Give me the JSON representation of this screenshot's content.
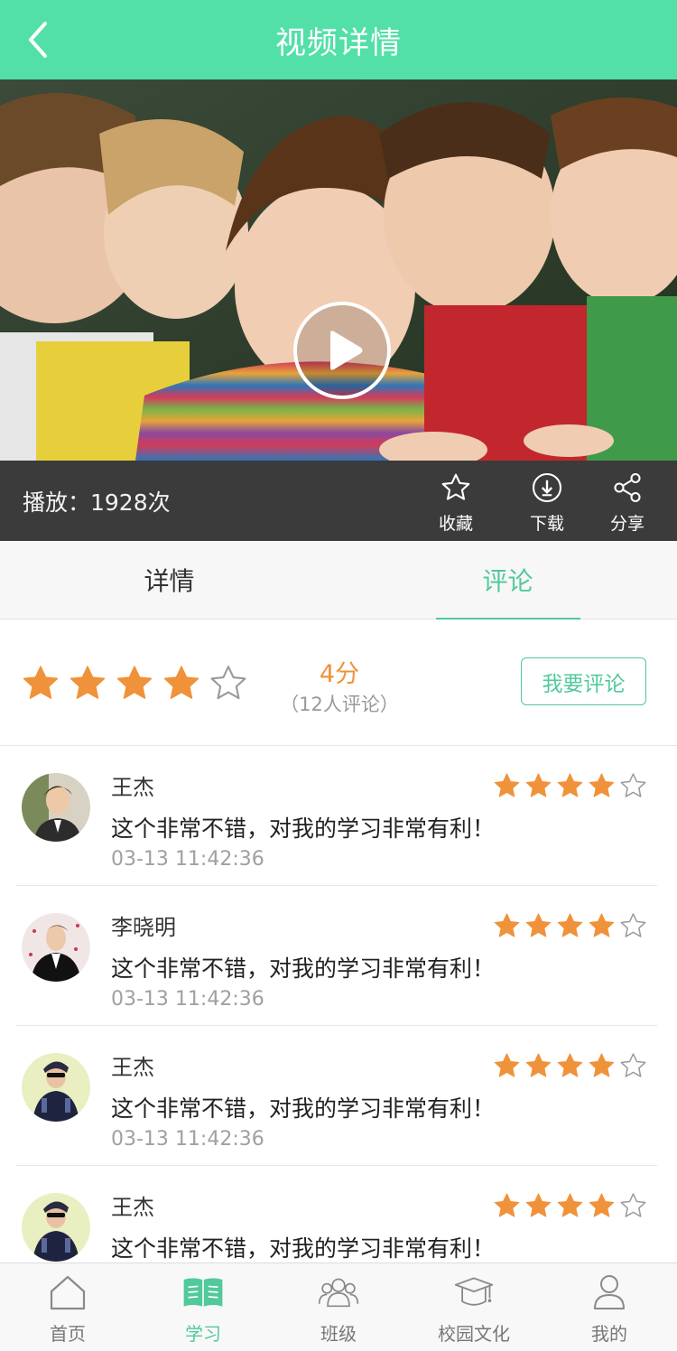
{
  "header": {
    "title": "视频详情",
    "back_icon": "chevron-left-icon"
  },
  "video": {
    "play_icon": "play-icon"
  },
  "stats": {
    "plays": "播放：1928次",
    "actions": [
      {
        "label": "收藏",
        "icon": "star-outline-icon"
      },
      {
        "label": "下载",
        "icon": "download-icon"
      },
      {
        "label": "分享",
        "icon": "share-icon"
      }
    ]
  },
  "tabs": [
    {
      "label": "详情",
      "active": false
    },
    {
      "label": "评论",
      "active": true
    }
  ],
  "summary": {
    "rating": 4,
    "max_rating": 5,
    "score_text": "4分",
    "count_text": "（12人评论）",
    "comment_button": "我要评论"
  },
  "comments": [
    {
      "name": "王杰",
      "text": "这个非常不错，对我的学习非常有利！",
      "time": "03-13 11:42:36",
      "rating": 4
    },
    {
      "name": "李晓明",
      "text": "这个非常不错，对我的学习非常有利！",
      "time": "03-13 11:42:36",
      "rating": 4
    },
    {
      "name": "王杰",
      "text": "这个非常不错，对我的学习非常有利！",
      "time": "03-13 11:42:36",
      "rating": 4
    },
    {
      "name": "王杰",
      "text": "这个非常不错，对我的学习非常有利！",
      "time": "",
      "rating": 4
    }
  ],
  "nav": [
    {
      "label": "首页",
      "icon": "home-icon",
      "active": false
    },
    {
      "label": "学习",
      "icon": "book-icon",
      "active": true
    },
    {
      "label": "班级",
      "icon": "group-icon",
      "active": false
    },
    {
      "label": "校园文化",
      "icon": "graduation-cap-icon",
      "active": false
    },
    {
      "label": "我的",
      "icon": "user-icon",
      "active": false
    }
  ],
  "colors": {
    "accent": "#52dfa8",
    "accent_text": "#52c99a",
    "star": "#f0923a",
    "stats_bar": "#3b3b3b"
  }
}
